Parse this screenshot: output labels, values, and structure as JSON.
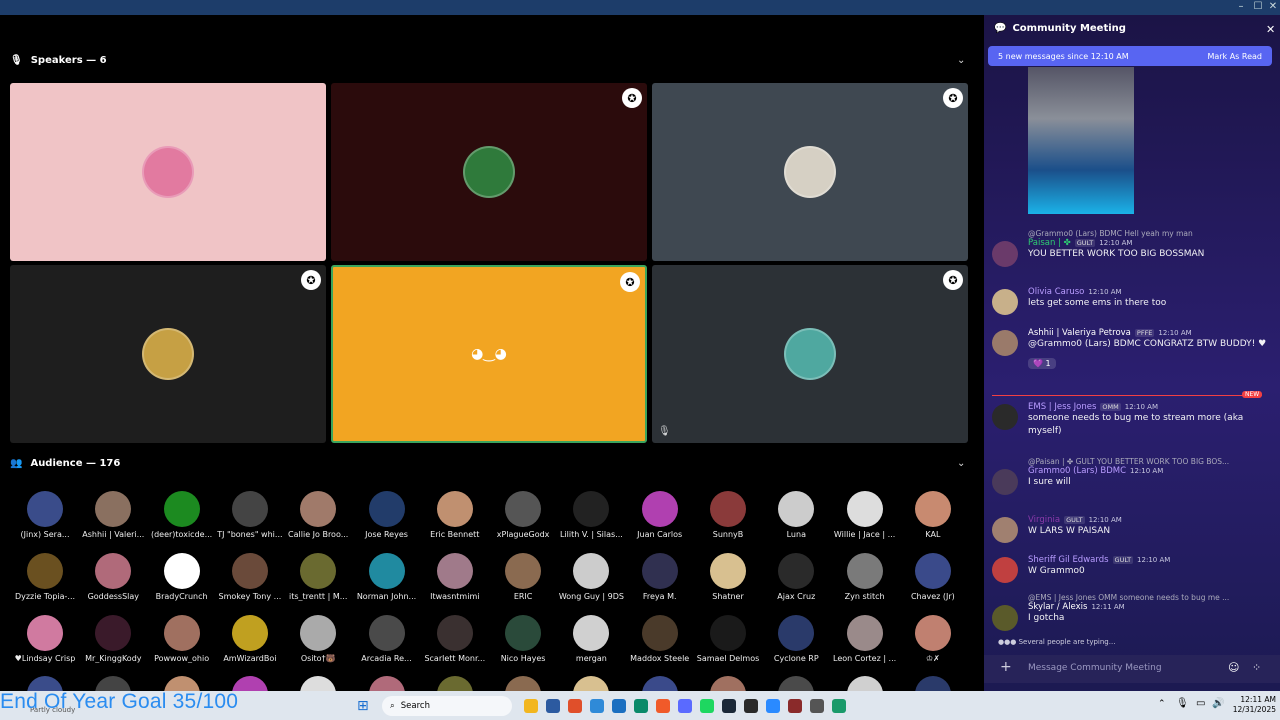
{
  "window": {
    "min": "–",
    "max": "☐",
    "close": "✕"
  },
  "stage": {
    "speakers_label": "Speakers — 6",
    "audience_label": "Audience — 176",
    "tiles": [
      {
        "bg": "#f0c4c6",
        "av": "#e27aa0",
        "badge": false,
        "mute": false
      },
      {
        "bg": "#2b0b0c",
        "av": "#2f7a3b",
        "badge": true,
        "mute": false
      },
      {
        "bg": "#3f4851",
        "av": "#d6d0c4",
        "badge": true,
        "mute": false
      },
      {
        "bg": "#1e1e1e",
        "av": "#c6a044",
        "badge": true,
        "mute": false
      },
      {
        "bg": "#f2a522",
        "av": "#f2a522",
        "badge": true,
        "mute": false,
        "discord": true
      },
      {
        "bg": "#2c3136",
        "av": "#4fa8a0",
        "badge": true,
        "mute": true
      }
    ],
    "audience": [
      [
        "(Jinx) Sera...",
        "Ashhii | Valeri...",
        "(deer)toxicde...",
        "TJ \"bones\" whi...",
        "Callie Jo Broo...",
        "Jose Reyes",
        "Eric Bennett",
        "xPlagueGodx",
        "Lilith V. | Silas...",
        "Juan Carlos",
        "SunnyB",
        "Luna",
        "Willie | Jace | ...",
        "KAL"
      ],
      [
        "Dyzzie Topia-...",
        "GoddessSlay",
        "BradyCrunch",
        "Smokey Tony ...",
        "its_trentt | M...",
        "Norman John...",
        "Itwasntmimi",
        "ERIC",
        "Wong Guy | 9DS",
        "Freya M.",
        "Shatner",
        "Ajax Cruz",
        "Zyn stitch",
        "Chavez (Jr)"
      ],
      [
        "♥Lindsay Crisp",
        "Mr_KinggKody",
        "Powwow_ohio",
        "AmWizardBoi",
        "Osito†🐻",
        "Arcadia Re...",
        "Scarlett Monr...",
        "Nico Hayes",
        "mergan",
        "Maddox Steele",
        "Samael Delmos",
        "Cyclone RP",
        "Leon Cortez | ...",
        "♔✗"
      ]
    ],
    "audience_colors": [
      "#3a4c8a",
      "#8a7060",
      "#1c8a20",
      "#444",
      "#a07a6a",
      "#223c6a",
      "#c09070",
      "#555",
      "#222",
      "#b040b0",
      "#8a3a3a",
      "#ccc",
      "#ddd",
      "#c88a70",
      "#6a5020",
      "#b06a7a",
      "#fff",
      "#6a4a3a",
      "#6a6a30",
      "#208aa0",
      "#a07a8a",
      "#8a6a50",
      "#ccc",
      "#303050",
      "#d8c090",
      "#2a2a2a",
      "#7a7a7a",
      "#3a4a8a",
      "#d07aa0",
      "#3a1a2a",
      "#a07060",
      "#c0a020",
      "#aaa",
      "#4a4a4a",
      "#3a3030",
      "#2a4a3a",
      "#d0d0d0",
      "#4a3a2a",
      "#1a1a1a",
      "#2a3a6a",
      "#9a8a8a",
      "#c08070"
    ]
  },
  "chat": {
    "title": "Community Meeting",
    "new_msgs": "5 new messages since 12:10 AM",
    "mark_read": "Mark As Read",
    "messages": [
      {
        "reply": "@Grammo0 (Lars) BDMC Hell yeah my man",
        "name": "Paisan | ✤",
        "tag": "GULT",
        "time": "12:10 AM",
        "text": "YOU BETTER WORK TOO BIG BOSSMAN",
        "color": "#2ecc71",
        "av": "#6a3a6a"
      },
      {
        "name": "Olivia Caruso",
        "time": "12:10 AM",
        "text": "lets get some ems in there too",
        "color": "#b89cff",
        "av": "#c8b08a"
      },
      {
        "name": "Ashhii | Valeriya Petrova",
        "tag": "PFFE",
        "time": "12:10 AM",
        "text": "@Grammo0 (Lars) BDMC CONGRATZ BTW BUDDY! ♥",
        "color": "#ffffff",
        "av": "#9a7a6a",
        "reaction": "💜 1"
      },
      {
        "new_label": "NEW",
        "name": "EMS | Jess Jones",
        "tag": "OMM",
        "time": "12:10 AM",
        "text": "someone needs to bug me to stream more (aka myself)",
        "color": "#b89cff",
        "av": "#2a2a2a"
      },
      {
        "reply": "@Paisan | ✤ GULT YOU BETTER WORK TOO BIG BOS...",
        "name": "Grammo0 (Lars) BDMC",
        "time": "12:10 AM",
        "text": "I sure will",
        "color": "#b89cff",
        "av": "#4a3a5a"
      },
      {
        "name": "Virginia",
        "tag": "GULT",
        "time": "12:10 AM",
        "text": "W LARS W PAISAN",
        "color": "#8a3aaa",
        "av": "#a08070"
      },
      {
        "name": "Sheriff Gil Edwards",
        "tag": "GULT",
        "time": "12:10 AM",
        "text": "W Grammo0",
        "color": "#b89cff",
        "av": "#c04040"
      },
      {
        "reply": "@EMS | Jess Jones OMM someone needs to bug me ...",
        "name": "Skylar / Alexis",
        "time": "12:11 AM",
        "text": "I gotcha",
        "color": "#ffffff",
        "av": "#5a5a2a"
      }
    ],
    "typing": "Several people are typing...",
    "composer_placeholder": "Message Community Meeting"
  },
  "overlay": {
    "goal": "End Of Year Goal 35/100",
    "weather": "Partly cloudy"
  },
  "taskbar": {
    "search": "Search",
    "time": "12:11 AM",
    "date": "12/31/2025"
  }
}
